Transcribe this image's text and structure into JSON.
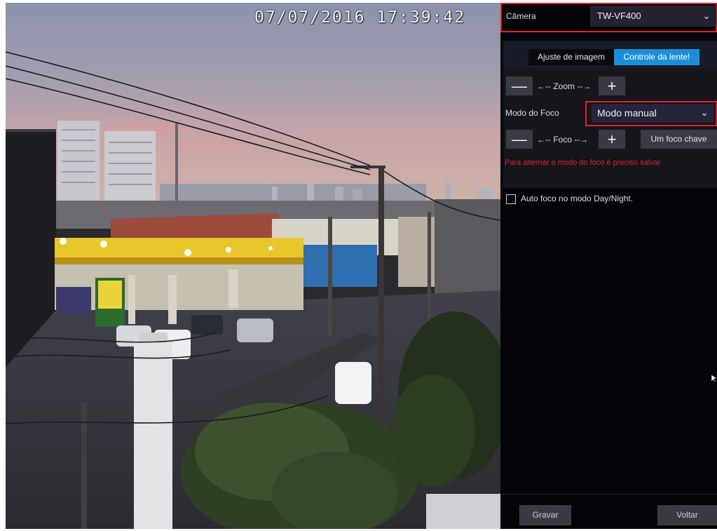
{
  "video": {
    "timestamp": "07/07/2016 17:39:42"
  },
  "panel": {
    "camera_label": "Câmera",
    "camera_value": "TW-VF400",
    "tabs": [
      "Ajuste de imagem",
      "Controle da lente!"
    ],
    "zoom_label": "Zoom",
    "focus_mode_label": "Modo do Foco",
    "focus_mode_value": "Modo manual",
    "focus_label": "Foco",
    "one_key_focus": "Um foco chave",
    "warning": "Para alternar o modo do foco é preciso salvar",
    "auto_focus_label": "Auto foco no modo Day/Night.",
    "save_label": "Gravar",
    "back_label": "Voltar",
    "minus": "—",
    "plus": "+"
  },
  "colors": {
    "highlight": "#e0202a",
    "accent": "#1a8fd8",
    "warning": "#e0222c",
    "panel_bg": "#050509"
  }
}
